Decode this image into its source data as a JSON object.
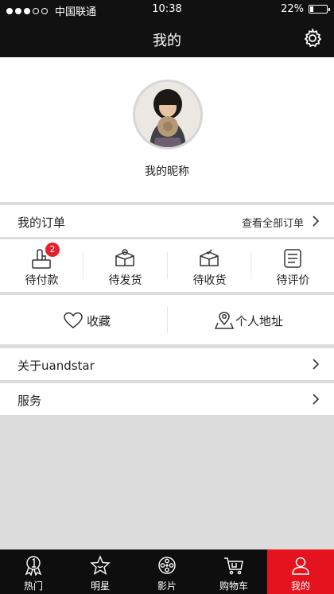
{
  "status_bar": {
    "carrier": "中国联通",
    "time": "10:38",
    "battery": "22%",
    "battery_level": 0.22,
    "signal_bars": 3,
    "signal_total": 5
  },
  "header": {
    "title": "我的",
    "settings_icon": "gear-icon"
  },
  "profile": {
    "nickname": "我的昵称",
    "avatar_icon": "avatar-photo"
  },
  "orders": {
    "title": "我的订单",
    "view_all": "查看全部订单",
    "items": [
      {
        "label": "待付款",
        "icon": "payment-icon",
        "badge": "2"
      },
      {
        "label": "待发货",
        "icon": "box-ship-icon"
      },
      {
        "label": "待收货",
        "icon": "box-receive-icon"
      },
      {
        "label": "待评价",
        "icon": "review-icon"
      }
    ]
  },
  "quick_links": [
    {
      "label": "收藏",
      "icon": "heart-icon"
    },
    {
      "label": "个人地址",
      "icon": "location-icon"
    }
  ],
  "menu": [
    {
      "label": "关于uandstar"
    },
    {
      "label": "服务"
    }
  ],
  "tab_bar": {
    "items": [
      {
        "label": "热门",
        "icon": "hot-medal-icon"
      },
      {
        "label": "明星",
        "icon": "star-icon"
      },
      {
        "label": "影片",
        "icon": "film-reel-icon"
      },
      {
        "label": "购物车",
        "icon": "cart-icon"
      },
      {
        "label": "我的",
        "icon": "user-icon",
        "active": true
      }
    ]
  },
  "colors": {
    "accent": "#e4131e",
    "badge": "#e2212a",
    "bar_bg": "#111111",
    "page_bg": "#dcdcdc"
  }
}
